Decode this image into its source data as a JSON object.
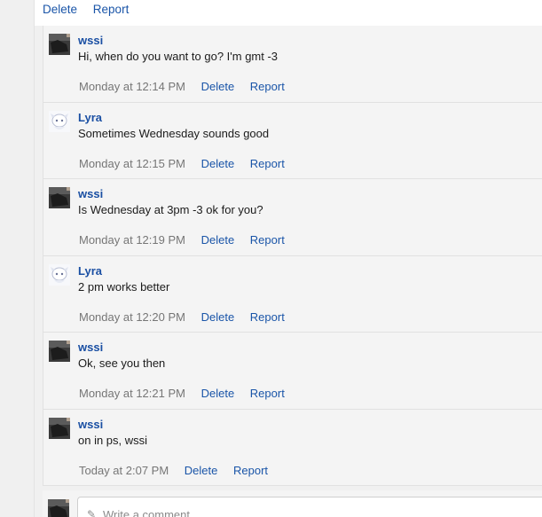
{
  "top_actions": {
    "delete": "Delete",
    "report": "Report"
  },
  "comments": [
    {
      "author": "wssi",
      "avatar": "dark-photo-avatar",
      "message": "Hi, when do you want to go? I'm gmt -3",
      "time": "Monday at 12:14 PM",
      "delete": "Delete",
      "report": "Report"
    },
    {
      "author": "Lyra",
      "avatar": "white-cartoon-avatar",
      "message": "Sometimes Wednesday sounds good",
      "time": "Monday at 12:15 PM",
      "delete": "Delete",
      "report": "Report"
    },
    {
      "author": "wssi",
      "avatar": "dark-photo-avatar",
      "message": "Is Wednesday at 3pm -3 ok for you?",
      "time": "Monday at 12:19 PM",
      "delete": "Delete",
      "report": "Report"
    },
    {
      "author": "Lyra",
      "avatar": "white-cartoon-avatar",
      "message": "2 pm works better",
      "time": "Monday at 12:20 PM",
      "delete": "Delete",
      "report": "Report"
    },
    {
      "author": "wssi",
      "avatar": "dark-photo-avatar",
      "message": "Ok, see you then",
      "time": "Monday at 12:21 PM",
      "delete": "Delete",
      "report": "Report"
    },
    {
      "author": "wssi",
      "avatar": "dark-photo-avatar",
      "message": "on in ps, wssi",
      "time": "Today at 2:07 PM",
      "delete": "Delete",
      "report": "Report"
    }
  ],
  "composer": {
    "placeholder": "Write a comment...",
    "icon": "pencil-icon"
  },
  "colors": {
    "link": "#1a55a8",
    "author": "#1a4fa3",
    "time": "#767676",
    "background": "#f4f4f4"
  }
}
